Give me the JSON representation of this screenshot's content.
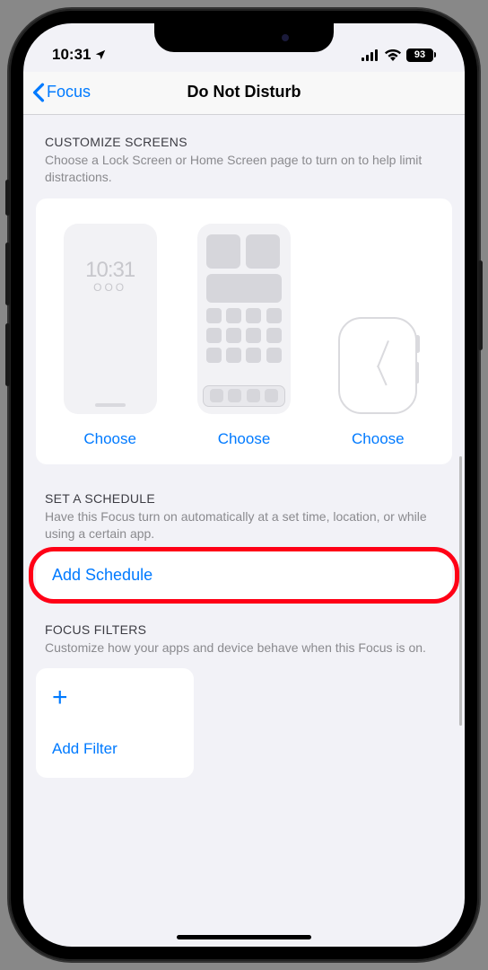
{
  "status": {
    "time": "10:31",
    "battery": "93"
  },
  "nav": {
    "back_label": "Focus",
    "title": "Do Not Disturb"
  },
  "customize": {
    "title": "CUSTOMIZE SCREENS",
    "desc": "Choose a Lock Screen or Home Screen page to turn on to help limit distractions.",
    "lock_time": "10:31",
    "lock_dots": "OOO",
    "choose_label": "Choose"
  },
  "schedule": {
    "title": "SET A SCHEDULE",
    "desc": "Have this Focus turn on automatically at a set time, location, or while using a certain app.",
    "add_label": "Add Schedule"
  },
  "filters": {
    "title": "FOCUS FILTERS",
    "desc": "Customize how your apps and device behave when this Focus is on.",
    "add_label": "Add Filter"
  }
}
